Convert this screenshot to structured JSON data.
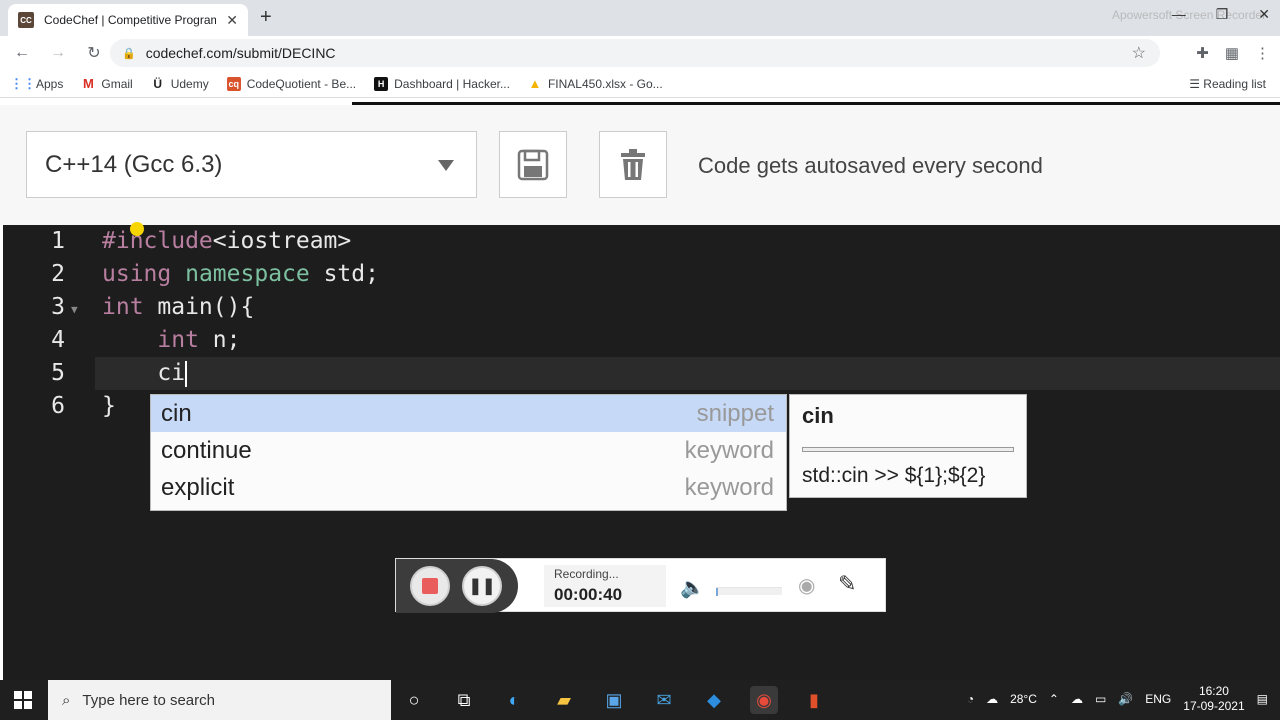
{
  "browser": {
    "tab_title": "CodeChef | Competitive Program",
    "tab_favicon": "CC",
    "url": "codechef.com/submit/DECINC",
    "watermark": "Apowersoft Screen Recorder",
    "bookmarks": [
      {
        "label": "Apps",
        "icon": "apps-grid-icon"
      },
      {
        "label": "Gmail",
        "icon": "gmail-icon"
      },
      {
        "label": "Udemy",
        "icon": "udemy-icon"
      },
      {
        "label": "CodeQuotient - Be...",
        "icon": "cq-icon"
      },
      {
        "label": "Dashboard | Hacker...",
        "icon": "hackerrank-icon"
      },
      {
        "label": "FINAL450.xlsx - Go...",
        "icon": "drive-icon"
      }
    ],
    "reading_list": "Reading list"
  },
  "toolbar": {
    "language": "C++14 (Gcc 6.3)",
    "autosave_text": "Code gets autosaved every second"
  },
  "editor": {
    "line_numbers": [
      "1",
      "2",
      "3",
      "4",
      "5",
      "6"
    ]
  },
  "autocomplete": {
    "items": [
      {
        "label": "cin",
        "meta": "snippet"
      },
      {
        "label": "continue",
        "meta": "keyword"
      },
      {
        "label": "explicit",
        "meta": "keyword"
      }
    ],
    "doc_title": "cin",
    "doc_body": "std::cin >> ${1};${2}"
  },
  "recorder": {
    "status": "Recording...",
    "time": "00:00:40",
    "volume_level": 0.03
  },
  "taskbar": {
    "search_placeholder": "Type here to search",
    "temperature": "28°C",
    "language": "ENG",
    "time": "16:20",
    "date": "17-09-2021"
  },
  "colors": {
    "editor_bg": "#1d1d1d",
    "keyword": "#b87fa0",
    "namespace": "#7cc0a0",
    "selection": "#c6d9f7"
  }
}
